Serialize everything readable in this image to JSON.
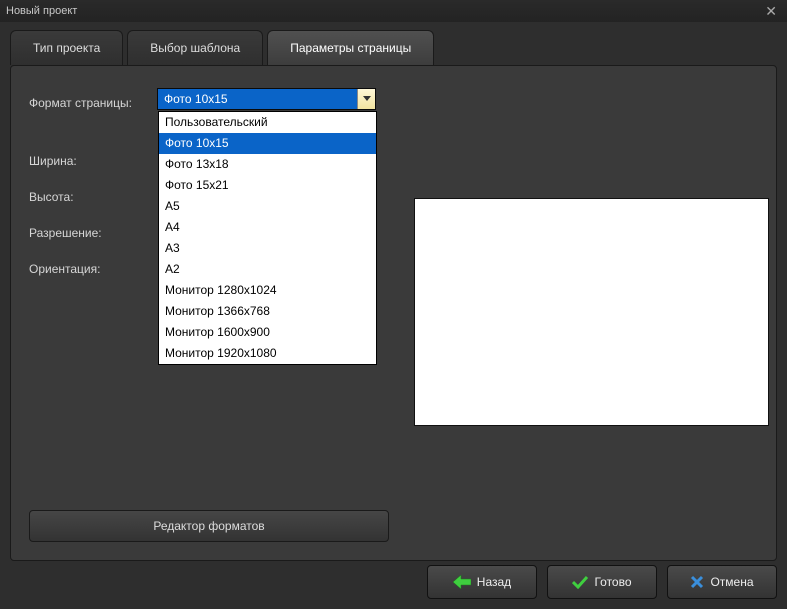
{
  "window": {
    "title": "Новый проект"
  },
  "tabs": [
    {
      "label": "Тип проекта"
    },
    {
      "label": "Выбор шаблона"
    },
    {
      "label": "Параметры страницы"
    }
  ],
  "form": {
    "page_format_label": "Формат страницы:",
    "width_label": "Ширина:",
    "height_label": "Высота:",
    "resolution_label": "Разрешение:",
    "orientation_label": "Ориентация:",
    "selected_format": "Фото 10x15",
    "options": [
      "Пользовательский",
      "Фото 10x15",
      "Фото 13x18",
      "Фото 15x21",
      "A5",
      "A4",
      "A3",
      "A2",
      "Монитор 1280x1024",
      "Монитор 1366x768",
      "Монитор 1600x900",
      "Монитор 1920x1080"
    ],
    "format_editor_label": "Редактор форматов"
  },
  "buttons": {
    "back": "Назад",
    "finish": "Готово",
    "cancel": "Отмена"
  }
}
